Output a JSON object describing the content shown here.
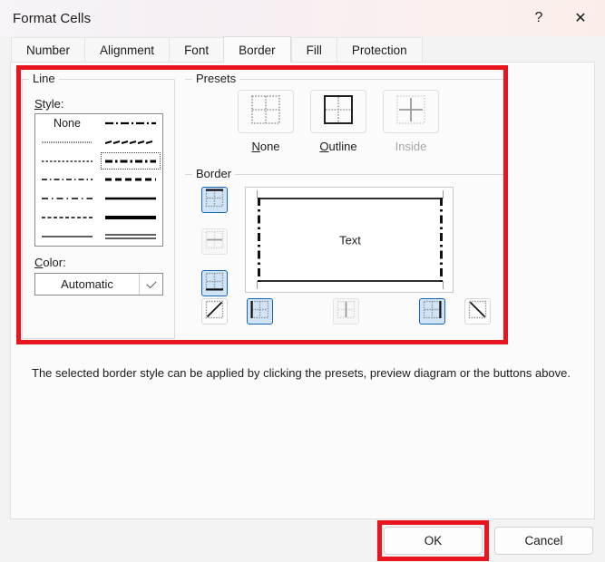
{
  "window": {
    "title": "Format Cells",
    "help_icon": "?",
    "close_icon": "✕"
  },
  "tabs": [
    {
      "label": "Number",
      "active": false
    },
    {
      "label": "Alignment",
      "active": false
    },
    {
      "label": "Font",
      "active": false
    },
    {
      "label": "Border",
      "active": true
    },
    {
      "label": "Fill",
      "active": false
    },
    {
      "label": "Protection",
      "active": false
    }
  ],
  "line_group": {
    "title": "Line",
    "style_label": "Style:",
    "none_label": "None",
    "styles": [
      {
        "id": "none",
        "column": "left",
        "row": 1,
        "selected": false
      },
      {
        "id": "hairline-dotted",
        "column": "left",
        "row": 2,
        "selected": false
      },
      {
        "id": "fine-dashed",
        "column": "left",
        "row": 3,
        "selected": false
      },
      {
        "id": "dash-dot-thin",
        "column": "left",
        "row": 4,
        "selected": false
      },
      {
        "id": "long-dash-dot-thin",
        "column": "left",
        "row": 5,
        "selected": false
      },
      {
        "id": "medium-dashed-thin",
        "column": "left",
        "row": 6,
        "selected": false
      },
      {
        "id": "thin-solid",
        "column": "left",
        "row": 7,
        "selected": false
      },
      {
        "id": "dash-dot-medium",
        "column": "right",
        "row": 1,
        "selected": false
      },
      {
        "id": "slanted-dash",
        "column": "right",
        "row": 2,
        "selected": false
      },
      {
        "id": "dash-dot-bold",
        "column": "right",
        "row": 3,
        "selected": true
      },
      {
        "id": "dashed-bold",
        "column": "right",
        "row": 4,
        "selected": false
      },
      {
        "id": "medium-solid",
        "column": "right",
        "row": 5,
        "selected": false
      },
      {
        "id": "thick-solid",
        "column": "right",
        "row": 6,
        "selected": false
      },
      {
        "id": "double-line",
        "column": "right",
        "row": 7,
        "selected": false
      }
    ],
    "color_label": "Color:",
    "color_value": "Automatic",
    "color_dropdown_icon": "chevron-down-icon"
  },
  "presets_group": {
    "title": "Presets",
    "items": [
      {
        "label": "None",
        "icon": "preset-none-icon",
        "enabled": true
      },
      {
        "label": "Outline",
        "icon": "preset-outline-icon",
        "enabled": true
      },
      {
        "label": "Inside",
        "icon": "preset-inside-icon",
        "enabled": false
      }
    ]
  },
  "border_group": {
    "title": "Border",
    "preview_text": "Text",
    "side_buttons": [
      {
        "id": "border-top",
        "icon": "border-top-icon",
        "state": "on"
      },
      {
        "id": "border-horizontal-middle",
        "icon": "border-horizontal-middle-icon",
        "state": "disabled"
      },
      {
        "id": "border-bottom",
        "icon": "border-bottom-icon",
        "state": "on"
      }
    ],
    "bottom_buttons": [
      {
        "id": "border-diagonal-up",
        "icon": "border-diagonal-up-icon",
        "state": "off"
      },
      {
        "id": "border-left",
        "icon": "border-left-icon",
        "state": "on"
      },
      {
        "id": "border-vertical-middle",
        "icon": "border-vertical-middle-icon",
        "state": "disabled"
      },
      {
        "id": "border-right",
        "icon": "border-right-icon",
        "state": "on"
      },
      {
        "id": "border-diagonal-down",
        "icon": "border-diagonal-down-icon",
        "state": "off"
      }
    ],
    "preview": {
      "top": "solid",
      "bottom": "solid",
      "left": "dash-dot",
      "right": "dash-dot"
    }
  },
  "hint_text": "The selected border style can be applied by clicking the presets, preview diagram or the buttons above.",
  "footer": {
    "ok_label": "OK",
    "cancel_label": "Cancel"
  },
  "annotations": {
    "highlight_color": "#e8151f",
    "boxes": [
      {
        "id": "border-settings-area"
      },
      {
        "id": "ok-button-area"
      }
    ]
  }
}
